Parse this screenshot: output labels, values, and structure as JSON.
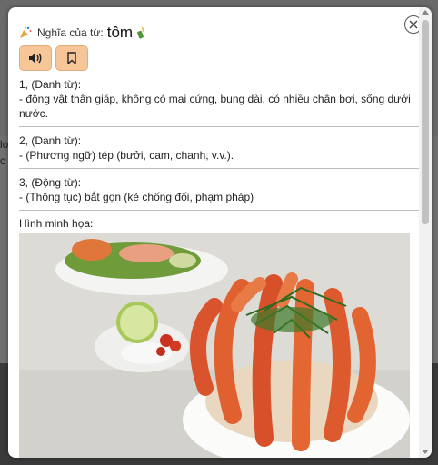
{
  "header": {
    "label": "Nghĩa của từ:",
    "word": "tôm"
  },
  "senses": [
    {
      "title": "1, (Danh từ):",
      "definition": "- động vật thân giáp, không có mai cứng, bụng dài, có nhiều chân bơi, sống dưới nước."
    },
    {
      "title": "2, (Danh từ):",
      "definition": "- (Phương ngữ) tép (bưởi, cam, chanh, v.v.)."
    },
    {
      "title": "3, (Động từ):",
      "definition": "- (Thông tục) bắt gọn (kẻ chống đối, phạm pháp)"
    }
  ],
  "illustration": {
    "label": "Hình minh họa:"
  },
  "background": {
    "left_snippet_1": "lo",
    "left_snippet_2": "c"
  },
  "colors": {
    "button_bg": "#f6c598",
    "modal_bg": "#ffffff",
    "overlay": "#5e5e5e"
  },
  "icons": [
    "party-popper-icon",
    "bottle-icon",
    "speaker-icon",
    "bookmark-icon",
    "close-icon"
  ]
}
